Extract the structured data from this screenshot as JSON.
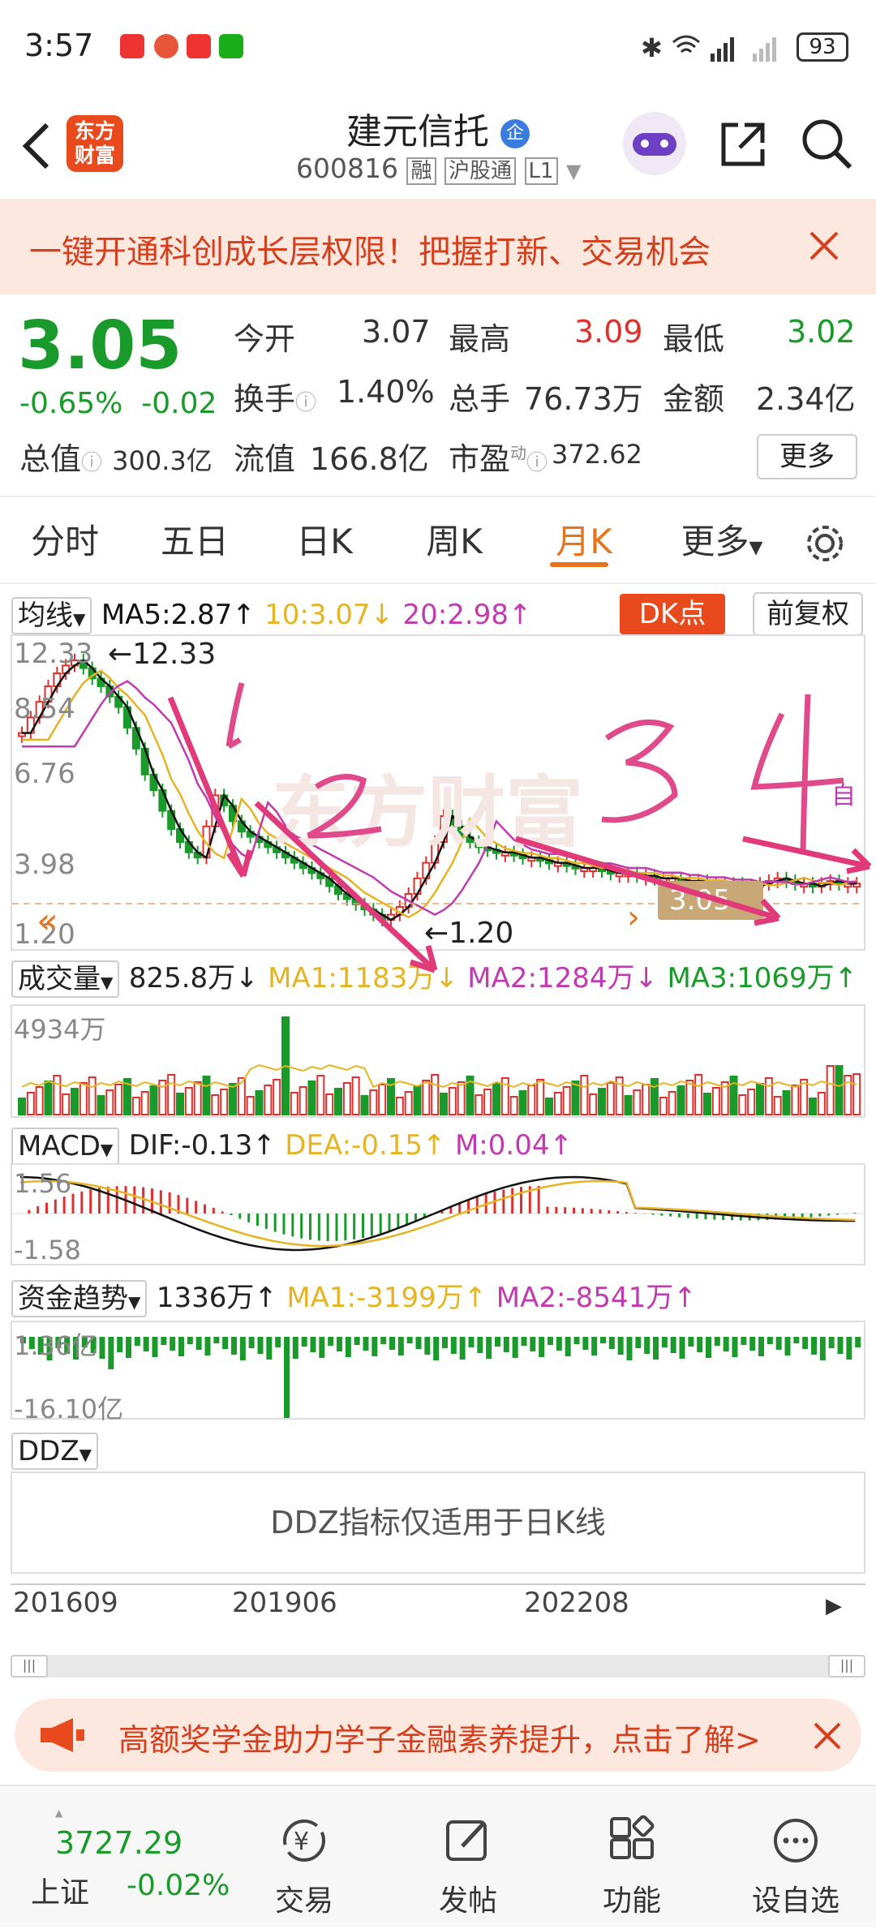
{
  "status_bar": {
    "time": "3:57",
    "battery": "93",
    "network": "4G"
  },
  "header": {
    "back_icon": "chevron-left-icon",
    "logo_text": [
      "东方",
      "财富"
    ],
    "stock_name": "建元信托",
    "badge": "企",
    "stock_code": "600816",
    "tags": [
      "融",
      "沪股通",
      "L1"
    ]
  },
  "banner": {
    "text": "一键开通科创成长层权限！把握打新、交易机会"
  },
  "quote": {
    "price": "3.05",
    "change_pct": "-0.65%",
    "change": "-0.02",
    "stats": [
      {
        "label": "今开",
        "value": "3.07"
      },
      {
        "label": "最高",
        "value": "3.09"
      },
      {
        "label": "最低",
        "value": "3.02"
      },
      {
        "label": "换手",
        "value": "1.40%"
      },
      {
        "label": "总手",
        "value": "76.73万"
      },
      {
        "label": "金额",
        "value": "2.34亿"
      },
      {
        "label": "总值",
        "value": "300.3亿"
      },
      {
        "label": "流值",
        "value": "166.8亿"
      },
      {
        "label": "市盈",
        "value": "372.62",
        "sup": "动"
      }
    ],
    "more_label": "更多"
  },
  "tabs": [
    "分时",
    "五日",
    "日K",
    "周K",
    "月K",
    "更多"
  ],
  "active_tab": "月K",
  "kline": {
    "ma_selector": "均线",
    "ma5": "MA5:2.87↑",
    "ma10": "10:3.07↓",
    "ma20": "20:2.98↑",
    "dk_label": "DK点",
    "adjust_label": "前复权",
    "y_top": "12.33",
    "y_mid1": "8.54",
    "y_mid2": "6.76",
    "y_mid3": "3.98",
    "y_bottom": "1.20",
    "high_label": "12.33",
    "low_label": "1.20",
    "watermark": "东方财富",
    "price_tag": "3.05",
    "auto_label": "自",
    "colors": {
      "up": "#e0302e",
      "down": "#1a9a2b",
      "ma5": "#111111",
      "ma10": "#e6b422",
      "ma20": "#c03ab0"
    }
  },
  "annotations": [
    "1",
    "2",
    "3",
    "4"
  ],
  "volume": {
    "selector": "成交量",
    "value": "825.8万↓",
    "ma1": "MA1:1183万↓",
    "ma2": "MA2:1284万↓",
    "ma3": "MA3:1069万↑",
    "y_top": "4934万"
  },
  "macd": {
    "selector": "MACD",
    "dif": "DIF:-0.13↑",
    "dea": "DEA:-0.15↑",
    "m": "M:0.04↑",
    "y_top": "1.56",
    "y_bottom": "-1.58"
  },
  "fund": {
    "selector": "资金趋势",
    "value": "1336万↑",
    "ma1": "MA1:-3199万↑",
    "ma2": "MA2:-8541万↑",
    "y_top": "1.36亿",
    "y_bottom": "-16.10亿"
  },
  "ddz": {
    "selector": "DDZ",
    "message": "DDZ指标仅适用于日K线"
  },
  "timeline": [
    "201609",
    "201906",
    "202208"
  ],
  "promo": {
    "text": "高额奖学金助力学子金融素养提升，点击了解>"
  },
  "bottom_nav": {
    "index_value": "3727.29",
    "index_name": "上证",
    "index_change": "-0.02%",
    "items": [
      "交易",
      "发帖",
      "功能",
      "设自选"
    ]
  }
}
